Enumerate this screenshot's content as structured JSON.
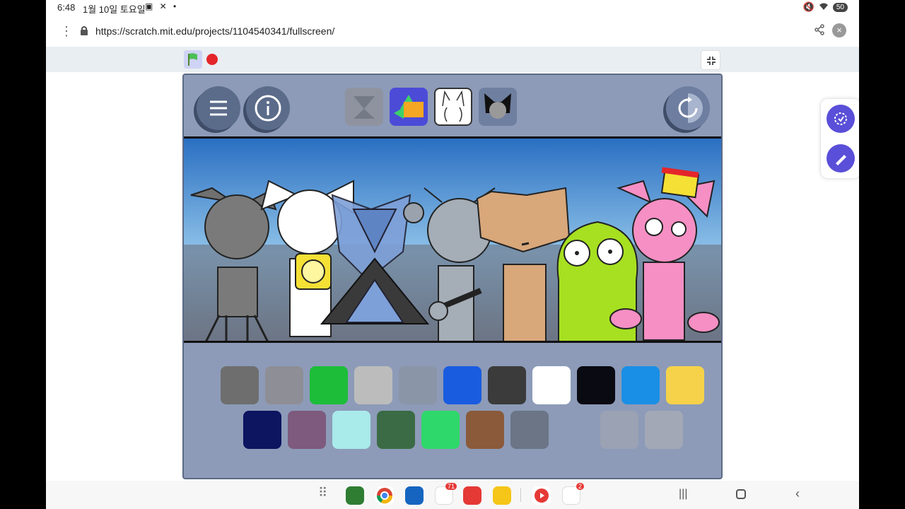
{
  "status_bar": {
    "time": "6:48",
    "date": "1월 10일 토요일",
    "notifications": "▣ ✕ •",
    "battery": "50"
  },
  "browser": {
    "url": "https://scratch.mit.edu/projects/1104540341/fullscreen/"
  },
  "colors": {
    "stage_bg": "#8d9bb8",
    "accent": "#5a4fd8",
    "stop": "#e4262a"
  },
  "taskbar": {
    "app_badge_1": "71",
    "app_badge_2": "2"
  }
}
